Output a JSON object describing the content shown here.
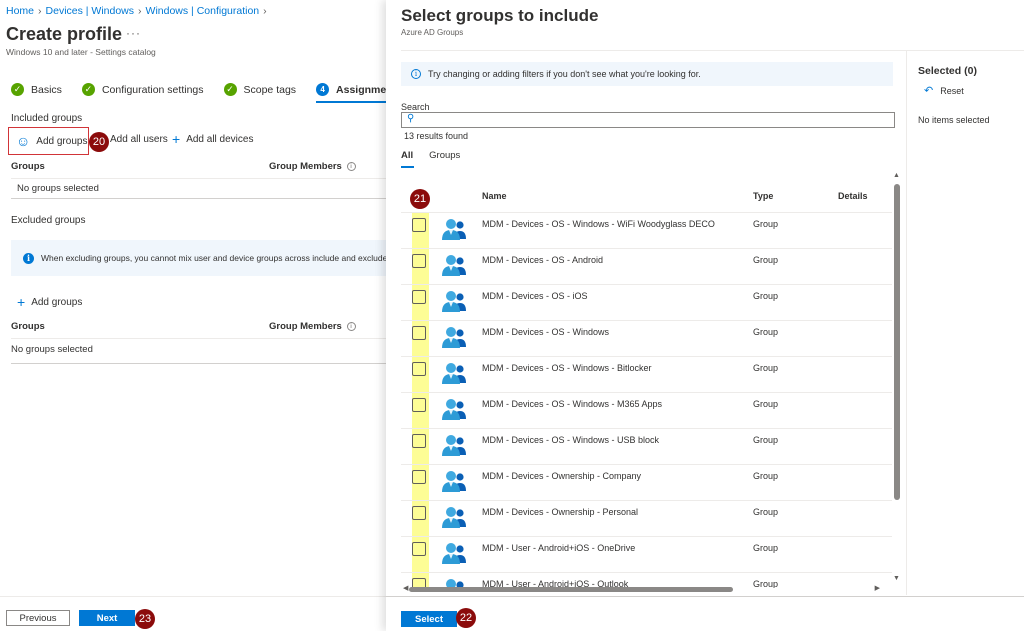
{
  "breadcrumb": [
    "Home",
    "Devices | Windows",
    "Windows | Configuration"
  ],
  "page": {
    "title": "Create profile",
    "more": "···",
    "subtitle": "Windows 10 and later - Settings catalog"
  },
  "wizard_steps": [
    {
      "label": "Basics",
      "state": "done"
    },
    {
      "label": "Configuration settings",
      "state": "done"
    },
    {
      "label": "Scope tags",
      "state": "done"
    },
    {
      "label": "Assignments",
      "state": "active",
      "number": "4"
    }
  ],
  "included": {
    "label": "Included groups",
    "add_groups": "Add groups",
    "add_all_users": "Add all users",
    "add_all_devices": "Add all devices",
    "col_groups": "Groups",
    "col_members": "Group Members",
    "empty": "No groups selected"
  },
  "excluded": {
    "label": "Excluded groups",
    "info": "When excluding groups, you cannot mix user and device groups across include and exclude. G",
    "add_groups": "Add groups",
    "col_groups": "Groups",
    "col_members": "Group Members",
    "empty": "No groups selected"
  },
  "footer": {
    "previous": "Previous",
    "next": "Next"
  },
  "callouts": {
    "add_groups": "20",
    "checkbox": "21",
    "select": "22",
    "next": "23"
  },
  "blade": {
    "title": "Select groups to include",
    "subtitle": "Azure AD Groups",
    "hint": "Try changing or adding filters if you don't see what you're looking for.",
    "search_label": "Search",
    "search_value": "",
    "results": "13 results found",
    "tabs": [
      "All",
      "Groups"
    ],
    "columns": {
      "name": "Name",
      "type": "Type",
      "details": "Details"
    },
    "rows": [
      {
        "name": "MDM - Devices - OS - Windows - WiFi Woodyglass DECO",
        "type": "Group"
      },
      {
        "name": "MDM - Devices - OS - Android",
        "type": "Group"
      },
      {
        "name": "MDM - Devices - OS - iOS",
        "type": "Group"
      },
      {
        "name": "MDM - Devices - OS - Windows",
        "type": "Group"
      },
      {
        "name": "MDM - Devices - OS - Windows - Bitlocker",
        "type": "Group"
      },
      {
        "name": "MDM - Devices - OS - Windows - M365 Apps",
        "type": "Group"
      },
      {
        "name": "MDM - Devices - OS - Windows - USB block",
        "type": "Group"
      },
      {
        "name": "MDM - Devices - Ownership - Company",
        "type": "Group"
      },
      {
        "name": "MDM - Devices - Ownership - Personal",
        "type": "Group"
      },
      {
        "name": "MDM - User - Android+iOS - OneDrive",
        "type": "Group"
      },
      {
        "name": "MDM - User - Android+iOS - Outlook",
        "type": "Group"
      }
    ],
    "select_button": "Select",
    "selected_title": "Selected (0)",
    "reset": "Reset",
    "no_items": "No items selected"
  },
  "colors": {
    "accent": "#0078d4",
    "success": "#57a300",
    "callout": "#8b0b0b",
    "highlight": "#fdfd96",
    "error_outline": "#d13438"
  }
}
